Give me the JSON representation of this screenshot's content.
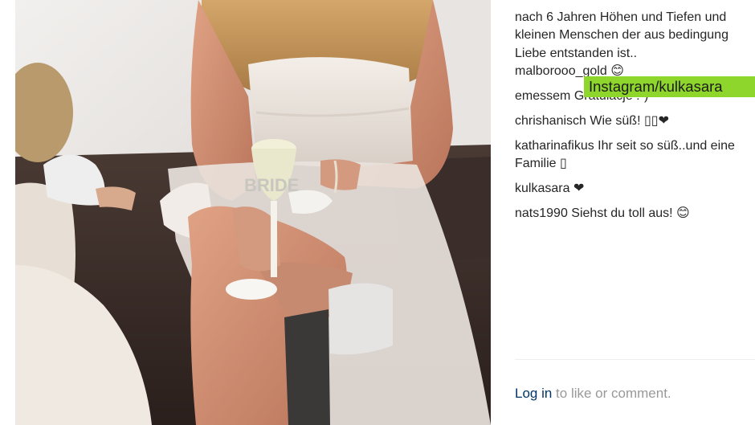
{
  "caption": {
    "lines": [
      "",
      "nach 6 Jahren Höhen und Tiefen und",
      "kleinen Menschen der aus bedingung",
      "Liebe entstanden ist.."
    ]
  },
  "comments": [
    {
      "user": "malborooo_gold",
      "text": "😊"
    },
    {
      "user": "emessem",
      "text": "Gratulacje :-)"
    },
    {
      "user": "chrishanisch",
      "text": "Wie süß! ▯▯❤"
    },
    {
      "user": "katharinafikus",
      "text": "Ihr seit so süß..und eine Familie ▯"
    },
    {
      "user": "kulkasara",
      "text": "❤"
    },
    {
      "user": "nats1990",
      "text": "Siehst du toll aus! 😊"
    }
  ],
  "watermark": "Instagram/kulkasara",
  "footer": {
    "login_link": "Log in",
    "login_rest": " to like or comment."
  },
  "photo": {
    "glass_text": "BRIDE"
  },
  "colors": {
    "watermark_bg": "#8ed62b",
    "link": "#003569",
    "muted": "#999999",
    "text": "#262626"
  }
}
